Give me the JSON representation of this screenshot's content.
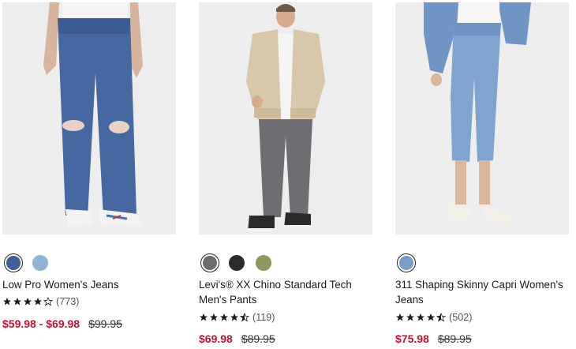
{
  "products": [
    {
      "name": "Low Pro Women's Jeans",
      "rating": 4,
      "reviews": "(773)",
      "sale_price": "$59.98 - $69.98",
      "original_price": "$99.95",
      "swatches": [
        {
          "color": "#3f5f95",
          "selected": true
        },
        {
          "color": "#8fb4d6",
          "selected": false
        }
      ]
    },
    {
      "name": "Levi's® XX Chino Standard Tech Men's Pants",
      "rating": 4.5,
      "reviews": "(119)",
      "sale_price": "$69.98",
      "original_price": "$89.95",
      "swatches": [
        {
          "color": "#6b6b70",
          "selected": true
        },
        {
          "color": "#2a2c30",
          "selected": false
        },
        {
          "color": "#8f965f",
          "selected": false
        }
      ]
    },
    {
      "name": "311 Shaping Skinny Capri Women's Jeans",
      "rating": 4.5,
      "reviews": "(502)",
      "sale_price": "$75.98",
      "original_price": "$89.95",
      "swatches": [
        {
          "color": "#7c9cc6",
          "selected": true
        }
      ]
    }
  ],
  "colors": {
    "sale": "#c41230",
    "photo_bg": "#ededed"
  }
}
